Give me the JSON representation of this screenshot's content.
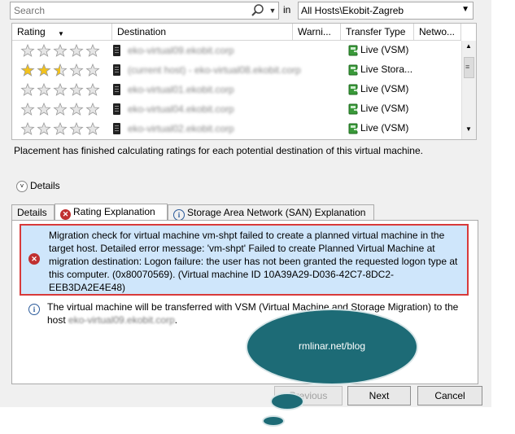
{
  "search": {
    "placeholder": "Search",
    "in_label": "in",
    "scope": "All Hosts\\Ekobit-Zagreb"
  },
  "grid": {
    "columns": [
      "Rating",
      "Destination",
      "Warni...",
      "Transfer Type",
      "Netwo..."
    ],
    "rows": [
      {
        "rating": 0,
        "destination": "eko-virtual09.ekobit.corp",
        "transfer": "Live (VSM)"
      },
      {
        "rating": 2.5,
        "destination": "(current host) - eko-virtual08.ekobit.corp",
        "transfer": "Live Stora..."
      },
      {
        "rating": 0,
        "destination": "eko-virtual01.ekobit.corp",
        "transfer": "Live (VSM)"
      },
      {
        "rating": 0,
        "destination": "eko-virtual04.ekobit.corp",
        "transfer": "Live (VSM)"
      },
      {
        "rating": 0,
        "destination": "eko-virtual02.ekobit.corp",
        "transfer": "Live (VSM)"
      }
    ]
  },
  "placement_message": "Placement has finished calculating ratings for each potential destination of this virtual machine.",
  "details_label": "Details",
  "tabs": [
    {
      "label": "Details",
      "icon": "none"
    },
    {
      "label": "Rating Explanation",
      "icon": "error-icon"
    },
    {
      "label": "Storage Area Network (SAN) Explanation",
      "icon": "info-icon"
    }
  ],
  "messages": {
    "error": "Migration check for virtual machine vm-shpt failed to create a planned virtual machine in the target host. Detailed error message: 'vm-shpt' Failed to create Planned Virtual Machine at migration destination: Logon failure: the user has not been granted the requested logon type at this computer. (0x80070569). (Virtual machine ID 10A39A29-D036-42C7-8DC2-EEB3DA2E4E48)",
    "info_prefix": "The virtual machine will be transferred with VSM (Virtual Machine and Storage Migration) to the host ",
    "info_host": "eko-virtual09.ekobit.corp",
    "info_suffix": "."
  },
  "buttons": {
    "previous": "Previous",
    "next": "Next",
    "cancel": "Cancel"
  },
  "watermark": "rmlinar.net/blog",
  "colors": {
    "selection": "#cfe6fb",
    "highlight_border": "#d83a3a",
    "bubble": "#1d6b76",
    "star": "#f3c21b"
  }
}
